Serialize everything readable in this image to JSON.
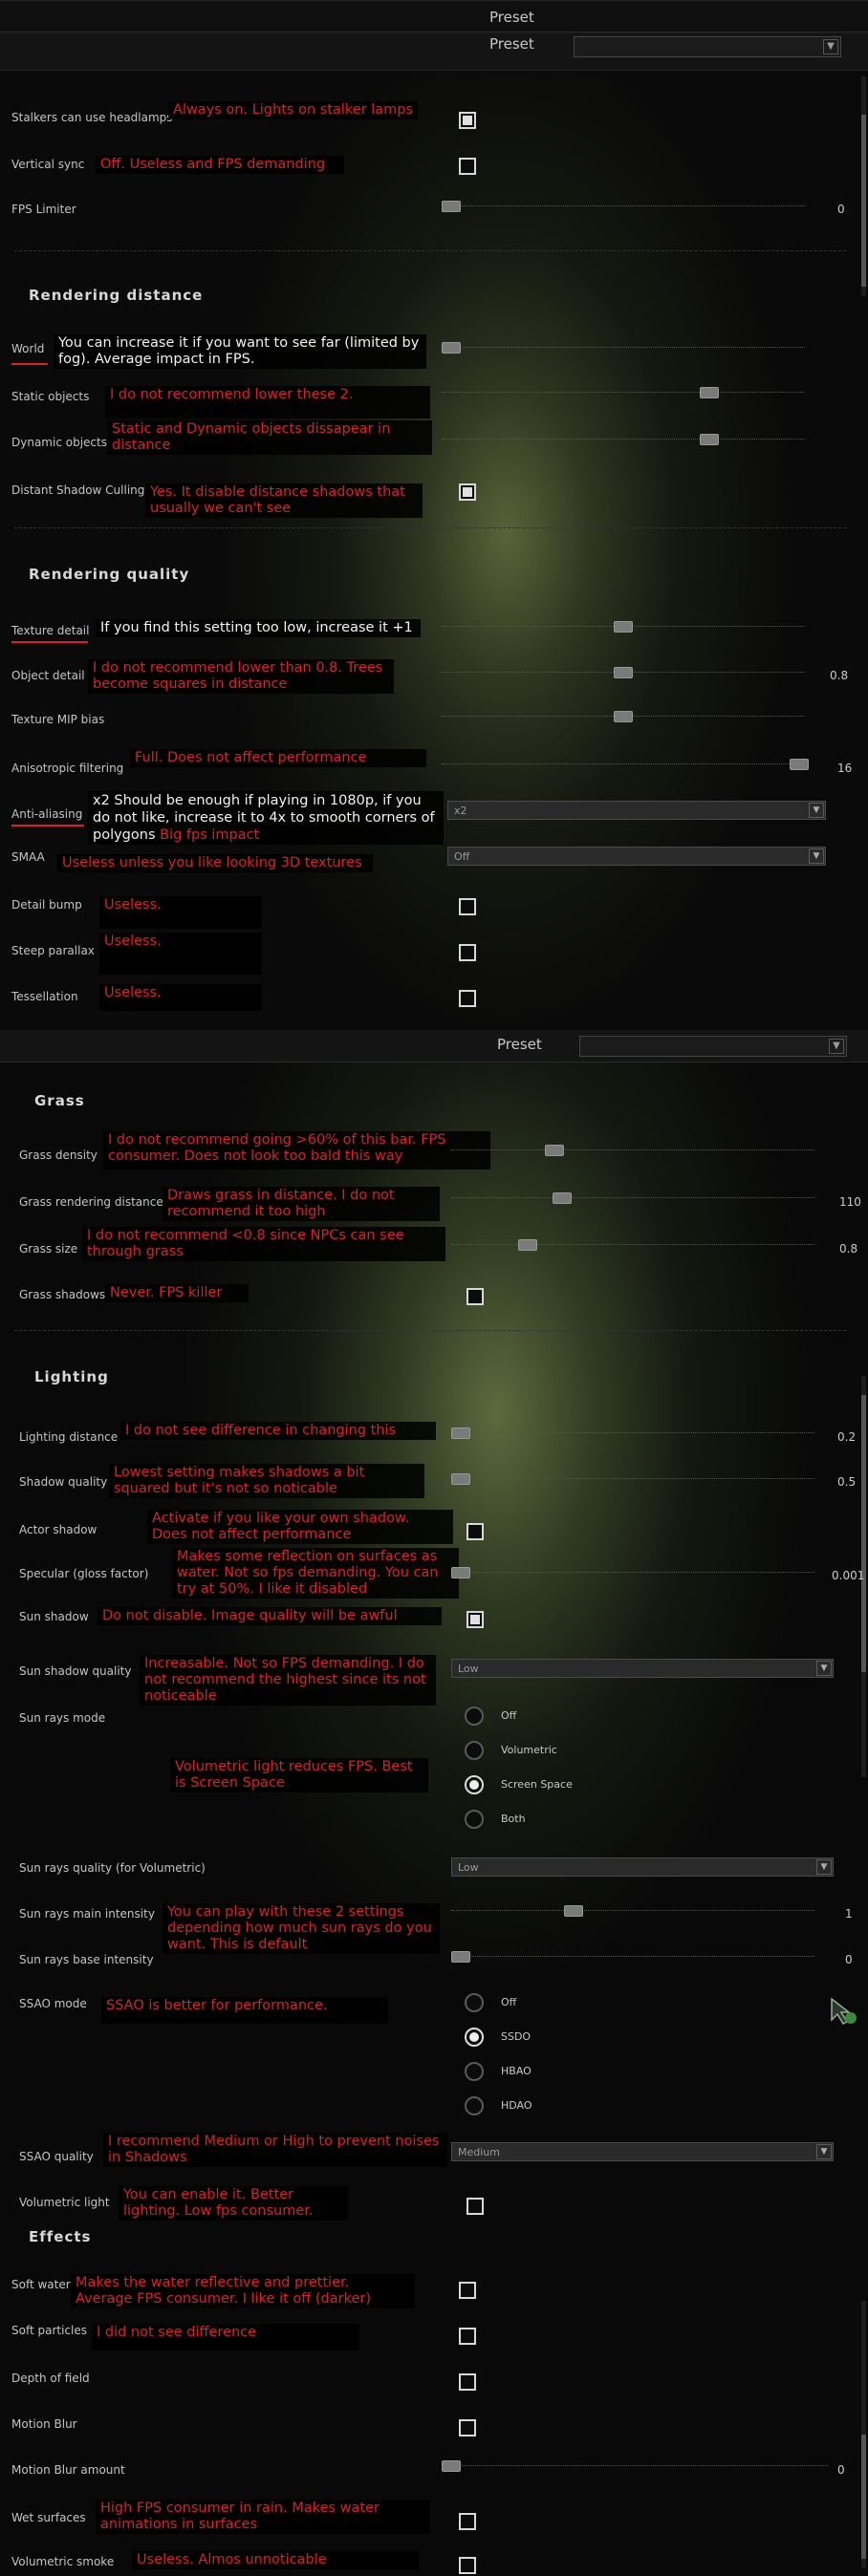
{
  "presets": {
    "label": "Preset"
  },
  "panel1": {
    "rows": {
      "headlamps": {
        "label": "Stalkers can use headlamps",
        "note": "Always on. Lights on stalker lamps",
        "checked": true
      },
      "vsync": {
        "label": "Vertical sync",
        "note": "Off. Useless and FPS demanding",
        "checked": false
      },
      "fps_limiter": {
        "label": "FPS Limiter",
        "value": "0"
      }
    },
    "rendering_distance": {
      "title": "Rendering distance",
      "world": {
        "label": "World",
        "note": "You can increase it if you want to see far (limited by fog). Average impact in FPS."
      },
      "static": {
        "label": "Static objects",
        "note": "I do not recommend lower these 2."
      },
      "dynamic": {
        "label": "Dynamic objects",
        "note": "Static and Dynamic objects dissapear in distance"
      },
      "shadow_culling": {
        "label": "Distant Shadow Culling",
        "note": "Yes. It disable distance shadows that usually we can't see",
        "checked": true
      }
    },
    "rendering_quality": {
      "title": "Rendering quality",
      "texture": {
        "label": "Texture detail",
        "note": "If you find this setting too low, increase it +1"
      },
      "object": {
        "label": "Object detail",
        "note": "I do not recommend lower than 0.8. Trees become squares in distance",
        "value": "0.8"
      },
      "mip": {
        "label": "Texture MIP bias"
      },
      "aniso": {
        "label": "Anisotropic filtering",
        "note": "Full. Does not affect performance",
        "value": "16"
      },
      "aa": {
        "label": "Anti-aliasing",
        "note": "x2 Should be enough if playing in 1080p, if you do not like, increase it to 4x to smooth corners of polygons",
        "note2": "Big fps impact",
        "value": "x2"
      },
      "smaa": {
        "label": "SMAA",
        "note": "Useless unless you like looking 3D textures",
        "value": "Off"
      },
      "bump": {
        "label": "Detail bump",
        "note": "Useless."
      },
      "parallax": {
        "label": "Steep parallax",
        "note": "Useless."
      },
      "tess": {
        "label": "Tessellation",
        "note": "Useless."
      }
    }
  },
  "panel2": {
    "grass": {
      "title": "Grass",
      "density": {
        "label": "Grass density",
        "note": "I do not recommend going >60% of this bar. FPS consumer. Does not look too bald this way"
      },
      "distance": {
        "label": "Grass rendering distance",
        "note": "Draws grass in distance. I do not recommend it too high",
        "value": "110"
      },
      "size": {
        "label": "Grass size",
        "note": "I do not recommend <0.8 since NPCs can see through grass",
        "value": "0.8"
      },
      "shadows": {
        "label": "Grass shadows",
        "note": "Never. FPS killer"
      }
    },
    "lighting": {
      "title": "Lighting",
      "distance": {
        "label": "Lighting distance",
        "note": "I do not see difference in changing this",
        "value": "0.2"
      },
      "shadow_quality": {
        "label": "Shadow quality",
        "note": "Lowest setting makes shadows a bit squared but it's not so noticable",
        "value": "0.5"
      },
      "actor_shadow": {
        "label": "Actor shadow",
        "note": "Activate if you like your own shadow. Does not affect performance"
      },
      "specular": {
        "label": "Specular (gloss factor)",
        "note": "Makes some reflection on surfaces as water. Not so fps demanding. You can try at 50%. I like it disabled",
        "value": "0.001"
      },
      "sun_shadow": {
        "label": "Sun shadow",
        "note": "Do not disable. Image quality will be awful",
        "checked": true
      },
      "sun_shadow_quality": {
        "label": "Sun shadow quality",
        "note": "Increasable. Not so FPS demanding. I do not recommend the highest since its not noticeable",
        "value": "Low"
      },
      "sun_rays_mode": {
        "label": "Sun rays mode",
        "note": "Volumetric light reduces FPS. Best is Screen Space",
        "options": [
          "Off",
          "Volumetric",
          "Screen Space",
          "Both"
        ],
        "selected": "Screen Space"
      },
      "sun_rays_quality": {
        "label": "Sun rays quality (for Volumetric)",
        "value": "Low"
      },
      "sun_rays_main": {
        "label": "Sun rays main intensity",
        "note": "You can play with these 2 settings depending how much sun rays do you want. This is default",
        "value": "1"
      },
      "sun_rays_base": {
        "label": "Sun rays base intensity",
        "value": "0"
      },
      "ssao_mode": {
        "label": "SSAO mode",
        "note": "SSAO is better for performance.",
        "options": [
          "Off",
          "SSDO",
          "HBAO",
          "HDAO"
        ],
        "selected": "SSDO"
      },
      "ssao_quality": {
        "label": "SSAO quality",
        "note": "I recommend Medium or High to prevent noises in Shadows",
        "value": "Medium"
      },
      "volumetric": {
        "label": "Volumetric light",
        "note": "You can enable it. Better lighting. Low fps consumer."
      }
    },
    "effects": {
      "title": "Effects",
      "soft_water": {
        "label": "Soft water",
        "note": "Makes the water reflective and prettier. Average FPS consumer. I like it off (darker)"
      },
      "soft_particles": {
        "label": "Soft particles",
        "note": "I did not see difference"
      },
      "dof": {
        "label": "Depth of field"
      },
      "motion_blur": {
        "label": "Motion Blur"
      },
      "motion_blur_amount": {
        "label": "Motion Blur amount",
        "value": "0"
      },
      "wet": {
        "label": "Wet surfaces",
        "note": "High FPS consumer in rain. Makes water animations in surfaces"
      },
      "vol_smoke": {
        "label": "Volumetric smoke",
        "note": "Useless. Almos unnoticable"
      }
    }
  }
}
